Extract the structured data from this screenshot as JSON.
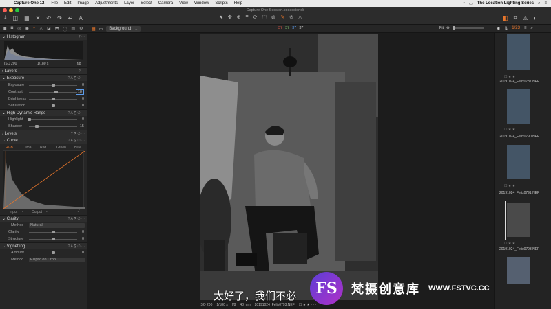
{
  "menubar": {
    "app": "Capture One 12",
    "items": [
      "File",
      "Edit",
      "Image",
      "Adjustments",
      "Layer",
      "Select",
      "Camera",
      "View",
      "Window",
      "Scripts",
      "Help"
    ],
    "right_text": "The Location Lighting Series"
  },
  "window": {
    "title": "Capture One Session.cosessiondb"
  },
  "subbar": {
    "background_label": "Background",
    "readout": {
      "r": "37",
      "g": "37",
      "b": "37",
      "a": "37"
    },
    "fit_label": "Fit",
    "count": "1/23"
  },
  "histogram": {
    "title": "Histogram",
    "iso": "ISO 200",
    "shutter": "1/180 s",
    "aperture": "f/8"
  },
  "layers": {
    "title": "Layers"
  },
  "exposure": {
    "title": "Exposure",
    "rows": [
      {
        "label": "Exposure",
        "value": "0",
        "level": 0.5
      },
      {
        "label": "Contrast",
        "value": "18",
        "level": 0.55
      },
      {
        "label": "Brightness",
        "value": "0",
        "level": 0.5
      },
      {
        "label": "Saturation",
        "value": "0",
        "level": 0.5
      }
    ]
  },
  "hdr": {
    "title": "High Dynamic Range",
    "rows": [
      {
        "label": "Highlight",
        "value": "0",
        "level": 0.0
      },
      {
        "label": "Shadow",
        "value": "15",
        "level": 0.15
      }
    ]
  },
  "levels": {
    "title": "Levels"
  },
  "curve": {
    "title": "Curve",
    "tabs": [
      "RGB",
      "Luma",
      "Red",
      "Green",
      "Blue"
    ],
    "input_label": "Input",
    "input_value": "-",
    "output_label": "Output",
    "output_value": "-"
  },
  "clarity": {
    "title": "Clarity",
    "method_label": "Method",
    "method_value": "Natural",
    "rows": [
      {
        "label": "Clarity",
        "value": "0",
        "level": 0.5
      },
      {
        "label": "Structure",
        "value": "0",
        "level": 0.5
      }
    ]
  },
  "vignetting": {
    "title": "Vignetting",
    "amount_label": "Amount",
    "amount_value": "0",
    "amount_level": 0.5,
    "method_label": "Method",
    "method_value": "Elliptic on Crop"
  },
  "browser": {
    "thumbs": [
      {
        "name": "20191024_Felix0787.NEF"
      },
      {
        "name": "20191024_Felix0790.NEF"
      },
      {
        "name": "20191024_Felix0791.NEF"
      },
      {
        "name": "20191024_Felix0793.NEF"
      }
    ]
  },
  "status": {
    "iso": "ISO 200",
    "shutter": "1/180 s",
    "aperture": "f/8",
    "focal": "48 mm",
    "filename": "20191024_Felix0793.NEF"
  },
  "overlay": {
    "subtitle": "太好了，我们不必",
    "logo_letters": "FS",
    "brand": "梵摄创意库",
    "url": "WWW.FSTVC.CC"
  },
  "colors": {
    "accent": "#e8762b",
    "panel": "#262626",
    "viewer": "#1c1c1c"
  }
}
